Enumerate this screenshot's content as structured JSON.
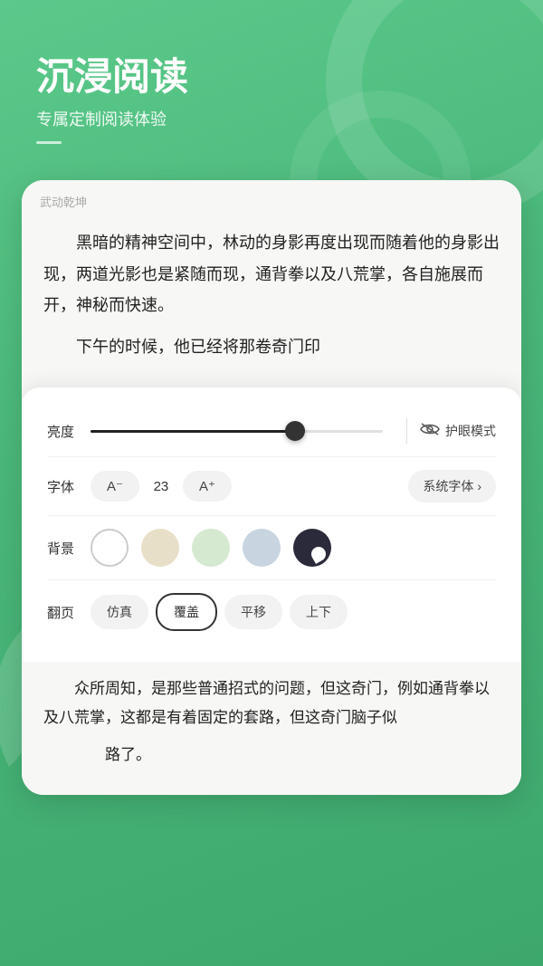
{
  "header": {
    "title": "沉浸阅读",
    "subtitle": "专属定制阅读体验"
  },
  "book": {
    "title": "武动乾坤",
    "paragraph1": "黑暗的精神空间中，林动的身影再度出现而随着他的身影出现，两道光影也是紧随而现，通背拳以及八荒掌，各自施展而开，神秘而快速。",
    "paragraph2": "下午的时候，他已经将那卷奇门印",
    "paragraph3": "众所周知，是那些普通招式的问题，但这奇门，例如通背拳以及八荒掌，这都是有着固定的套路，但这奇门脑子似乎有点路了。"
  },
  "settings": {
    "brightness_label": "亮度",
    "brightness_value": 70,
    "eye_mode_label": "护眼模式",
    "font_label": "字体",
    "font_decrease": "A⁻",
    "font_size": "23",
    "font_increase": "A⁺",
    "font_family": "系统字体",
    "font_family_arrow": "›",
    "background_label": "背景",
    "pageturn_label": "翻页",
    "pageturn_options": [
      "仿真",
      "覆盖",
      "平移",
      "上下"
    ],
    "pageturn_active": "覆盖"
  },
  "icons": {
    "eye": "ﾐ",
    "chevron": "›"
  }
}
